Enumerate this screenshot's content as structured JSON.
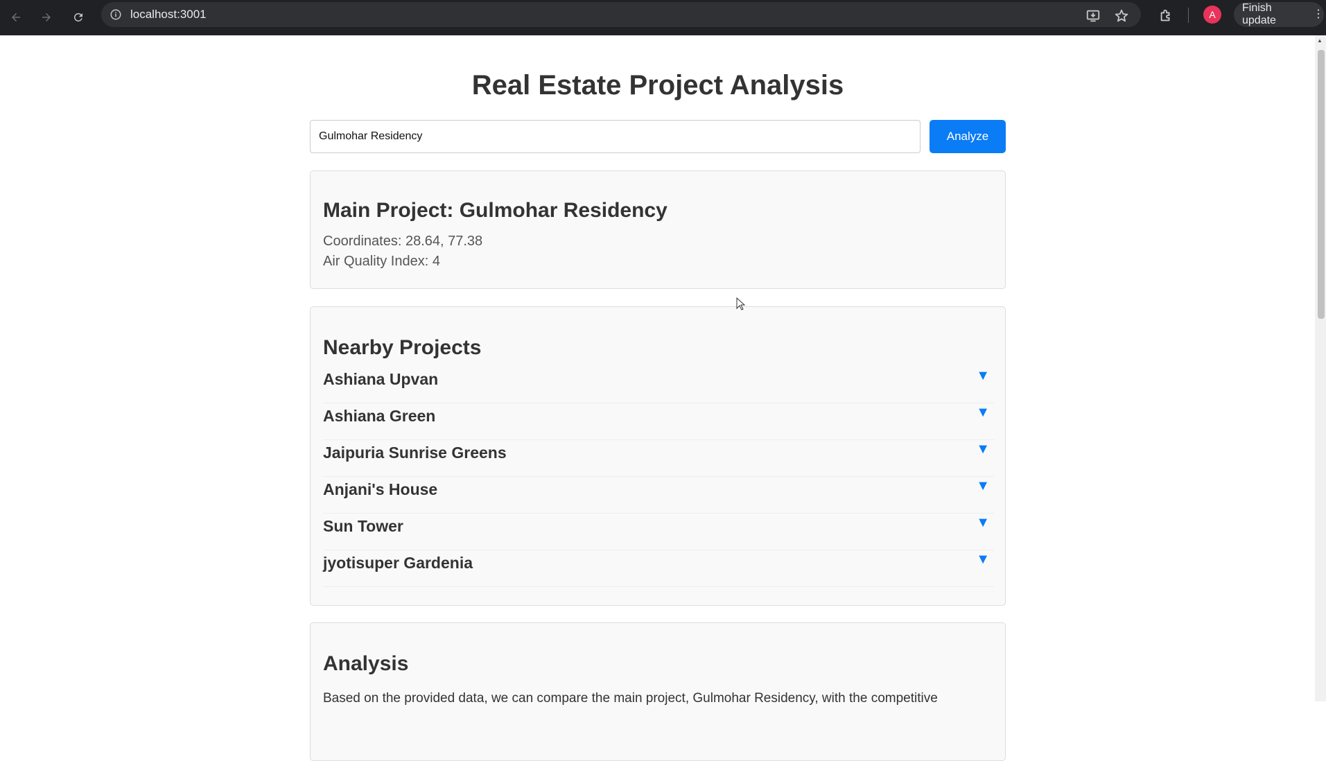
{
  "browser": {
    "url": "localhost:3001",
    "avatar_letter": "A",
    "update_label": "Finish update"
  },
  "page": {
    "title": "Real Estate Project Analysis",
    "search": {
      "value": "Gulmohar Residency",
      "button_label": "Analyze"
    },
    "main_project": {
      "heading": "Main Project: Gulmohar Residency",
      "coordinates": "Coordinates: 28.64, 77.38",
      "aqi": "Air Quality Index: 4"
    },
    "nearby": {
      "heading": "Nearby Projects",
      "items": [
        {
          "name": "Ashiana Upvan"
        },
        {
          "name": "Ashiana Green"
        },
        {
          "name": "Jaipuria Sunrise Greens"
        },
        {
          "name": "Anjani's House"
        },
        {
          "name": "Sun Tower"
        },
        {
          "name": "jyotisuper Gardenia"
        }
      ],
      "toggle_glyph": "▼"
    },
    "analysis": {
      "heading": "Analysis",
      "text": "Based on the provided data, we can compare the main project, Gulmohar Residency, with the competitive"
    }
  },
  "colors": {
    "accent": "#0a7cf5",
    "browser_bar": "#202124"
  }
}
